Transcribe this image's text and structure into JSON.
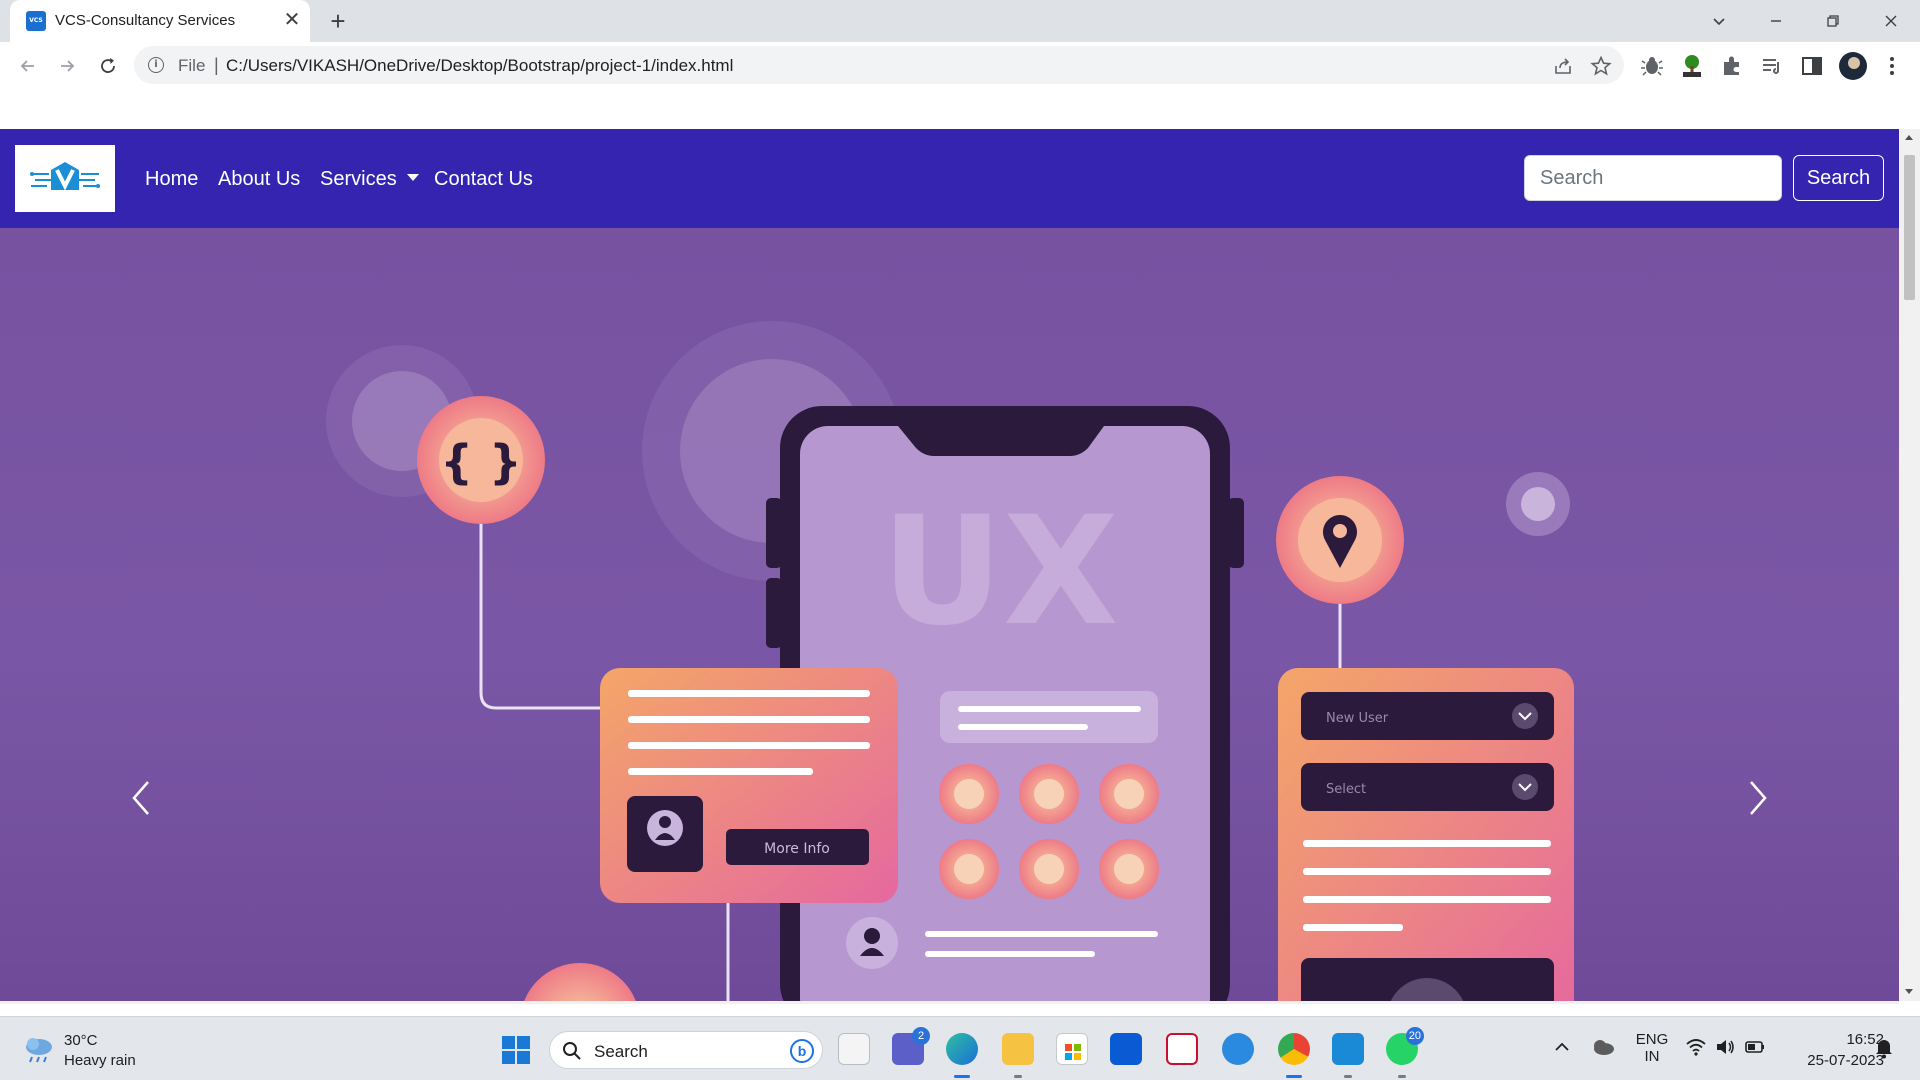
{
  "browser": {
    "tab_title": "VCS-Consultancy Services",
    "tab_favicon_text": "VCS",
    "tab_close": "✕",
    "new_tab": "+",
    "address": {
      "scheme_label": "File",
      "separator": "|",
      "url": "C:/Users/VIKASH/OneDrive/Desktop/Bootstrap/project-1/index.html"
    }
  },
  "page": {
    "nav_links": {
      "home": "Home",
      "about": "About Us",
      "services": "Services",
      "contact": "Contact Us"
    },
    "search": {
      "placeholder": "Search",
      "button_label": "Search"
    },
    "carousel": {
      "hero_text": "UX",
      "card_button_text": "More Info",
      "dropdown_1": "New User",
      "dropdown_2": "Select",
      "braces_glyph": "{ }"
    }
  },
  "taskbar": {
    "weather": {
      "temperature": "30°C",
      "condition": "Heavy rain"
    },
    "search_label": "Search",
    "bing_label": "b",
    "teams_badge": "2",
    "whatsapp_badge": "20",
    "language": {
      "line1": "ENG",
      "line2": "IN"
    },
    "clock": {
      "time": "16:52",
      "date": "25-07-2023"
    }
  },
  "colors": {
    "navbar": "#3424b0",
    "hero_bg": "#7752a1",
    "card_gradient_start": "#f39a6c",
    "card_gradient_end": "#e66aa0"
  }
}
